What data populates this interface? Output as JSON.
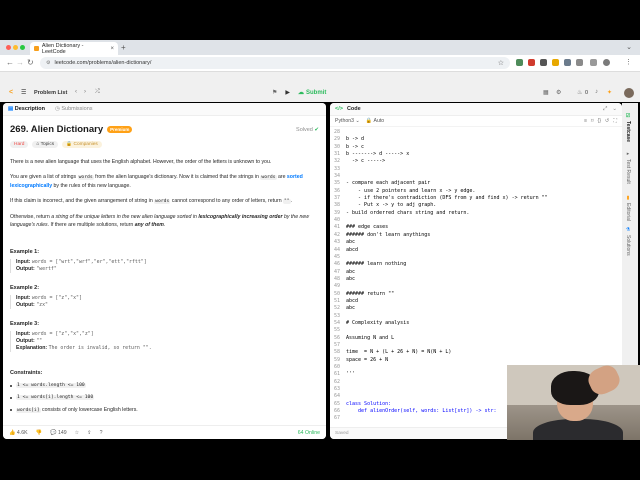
{
  "browser": {
    "tab_title": "Alien Dictionary - LeetCode",
    "url": "leetcode.com/problems/alien-dictionary/"
  },
  "header": {
    "problem_list": "Problem List",
    "run_label": "Run",
    "submit_label": "Submit",
    "streak": "0",
    "premium_label": "Premium"
  },
  "left_panel": {
    "tab_description": "Description",
    "tab_submissions": "Submissions",
    "title": "269. Alien Dictionary",
    "premium_badge": "Premium",
    "solved": "Solved",
    "tags": {
      "difficulty": "Hard",
      "topics": "Topics",
      "companies": "Companies"
    },
    "p1": "There is a new alien language that uses the English alphabet. However, the order of the letters is unknown to you.",
    "p2_a": "You are given a list of strings ",
    "p2_code": "words",
    "p2_b": " from the alien language's dictionary. Now it is claimed that the strings in ",
    "p2_code2": "words",
    "p2_c": " are ",
    "p2_hl": "sorted lexicographically",
    "p2_d": " by the rules of this new language.",
    "p3_a": "If this claim is incorrect, and the given arrangement of string in ",
    "p3_code": "words",
    "p3_b": " cannot correspond to any order of letters, return ",
    "p3_code2": "\"\"",
    "p3_c": ".",
    "p4_a": "Otherwise, return ",
    "p4_it": "a string of the unique letters in the new alien language sorted in ",
    "p4_bold": "lexicographically increasing order",
    "p4_it2": " by the new language's rules",
    "p4_b": ". If there are multiple solutions, return ",
    "p4_bold2": "any of them",
    "p4_c": ".",
    "examples": [
      {
        "title": "Example 1:",
        "input": "words = [\"wrt\",\"wrf\",\"er\",\"ett\",\"rftt\"]",
        "output": "\"wertf\""
      },
      {
        "title": "Example 2:",
        "input": "words = [\"z\",\"x\"]",
        "output": "\"zx\""
      },
      {
        "title": "Example 3:",
        "input": "words = [\"z\",\"x\",\"z\"]",
        "output": "\"\"",
        "explanation": "The order is invalid, so return \"\"."
      }
    ],
    "labels": {
      "input": "Input:",
      "output": "Output:",
      "explanation": "Explanation:"
    },
    "constraints_title": "Constraints:",
    "constraints": [
      {
        "code": "1 <= words.length <= 100",
        "text": ""
      },
      {
        "code": "1 <= words[i].length <= 100",
        "text": ""
      },
      {
        "code": "words[i]",
        "text": " consists of only lowercase English letters."
      }
    ],
    "footer": {
      "likes": "4.6K",
      "comments": "149",
      "online": "64 Online"
    }
  },
  "code_panel": {
    "title": "Code",
    "language": "Python3",
    "autocomplete": "Auto",
    "saved": "Saved",
    "lines": [
      {
        "n": "28",
        "t": "",
        "c": ""
      },
      {
        "n": "29",
        "t": "b -> d",
        "c": ""
      },
      {
        "n": "30",
        "t": "b -> c",
        "c": ""
      },
      {
        "n": "31",
        "t": "b -------> d -----> x",
        "c": ""
      },
      {
        "n": "32",
        "t": "  -> c ----->",
        "c": ""
      },
      {
        "n": "33",
        "t": "",
        "c": ""
      },
      {
        "n": "34",
        "t": "",
        "c": ""
      },
      {
        "n": "35",
        "t": "- compare each adjacent pair",
        "c": ""
      },
      {
        "n": "36",
        "t": "    - use 2 pointers and learn x -> y edge.",
        "c": ""
      },
      {
        "n": "37",
        "t": "    - if there's contradiction (DFS from y and find x) -> return \"\"",
        "c": ""
      },
      {
        "n": "38",
        "t": "    - Put x -> y to adj graph.",
        "c": ""
      },
      {
        "n": "39",
        "t": "- build orderred chars string and return.",
        "c": ""
      },
      {
        "n": "40",
        "t": "",
        "c": ""
      },
      {
        "n": "41",
        "t": "### edge cases",
        "c": ""
      },
      {
        "n": "42",
        "t": "###### don't learn anythings",
        "c": ""
      },
      {
        "n": "43",
        "t": "abc",
        "c": ""
      },
      {
        "n": "44",
        "t": "abcd",
        "c": ""
      },
      {
        "n": "45",
        "t": "",
        "c": ""
      },
      {
        "n": "46",
        "t": "###### learn nothing",
        "c": ""
      },
      {
        "n": "47",
        "t": "abc",
        "c": ""
      },
      {
        "n": "48",
        "t": "abc",
        "c": ""
      },
      {
        "n": "49",
        "t": "",
        "c": ""
      },
      {
        "n": "50",
        "t": "###### return \"\"",
        "c": ""
      },
      {
        "n": "51",
        "t": "abcd",
        "c": ""
      },
      {
        "n": "52",
        "t": "abc",
        "c": ""
      },
      {
        "n": "53",
        "t": "",
        "c": ""
      },
      {
        "n": "54",
        "t": "# Complexity analysis",
        "c": ""
      },
      {
        "n": "55",
        "t": "",
        "c": ""
      },
      {
        "n": "56",
        "t": "Assuming N and L",
        "c": ""
      },
      {
        "n": "57",
        "t": "",
        "c": ""
      },
      {
        "n": "58",
        "t": "time  = N + (L + 26 + N) = N(N + L)",
        "c": ""
      },
      {
        "n": "59",
        "t": "space = 26 + N",
        "c": ""
      },
      {
        "n": "60",
        "t": "",
        "c": ""
      },
      {
        "n": "61",
        "t": "'''",
        "c": ""
      },
      {
        "n": "62",
        "t": "",
        "c": ""
      },
      {
        "n": "63",
        "t": "",
        "c": ""
      },
      {
        "n": "64",
        "t": "",
        "c": ""
      },
      {
        "n": "65",
        "t": "class Solution:",
        "c": "kw"
      },
      {
        "n": "66",
        "t": "    def alienOrder(self, words: List[str]) -> str:",
        "c": "kw"
      },
      {
        "n": "67",
        "t": "",
        "c": ""
      }
    ]
  },
  "side_tabs": {
    "testcase": "Testcase",
    "test_result": "Test Result",
    "editorial": "Editorial",
    "solutions": "Solutions"
  },
  "colors": {
    "accent_green": "#2cbb5d",
    "premium_orange": "#ffa116",
    "hard_red": "#ef4743",
    "link_blue": "#007aff"
  }
}
